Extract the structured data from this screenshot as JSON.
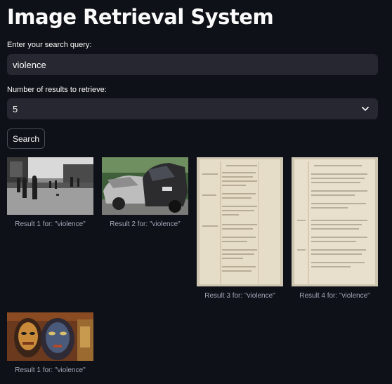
{
  "page": {
    "title": "Image Retrieval System"
  },
  "search": {
    "label": "Enter your search query:",
    "value": "violence"
  },
  "results_select": {
    "label": "Number of results to retrieve:",
    "value": "5"
  },
  "search_button": {
    "label": "Search"
  },
  "results": [
    {
      "caption": "Result 1 for: \"violence\"",
      "image": "street-protest-photo"
    },
    {
      "caption": "Result 2 for: \"violence\"",
      "image": "car-crash-photo"
    },
    {
      "caption": "Result 3 for: \"violence\"",
      "image": "handwritten-ledger-page"
    },
    {
      "caption": "Result 4 for: \"violence\"",
      "image": "handwritten-ledger-page"
    },
    {
      "caption": "Result 1 for: \"violence\"",
      "image": "carved-masks-photo"
    }
  ],
  "icons": {
    "select_chevron": "chevron-down-icon"
  },
  "colors": {
    "background": "#0e1117",
    "input_background": "#262730",
    "text": "#fafafa",
    "caption": "#a3a8b8"
  }
}
